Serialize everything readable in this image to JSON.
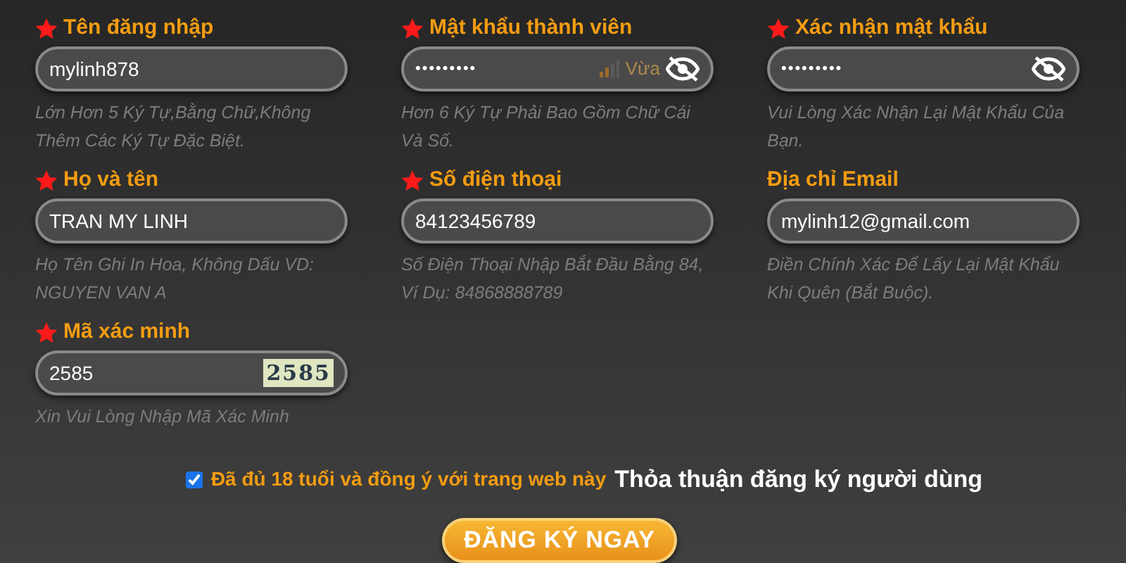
{
  "fields": [
    {
      "kind": "text",
      "label": "Tên đăng nhập",
      "required": true,
      "value": "mylinh878",
      "hint": "Lớn Hơn 5 Ký Tự,Bằng Chữ,Không Thêm Các Ký Tự Đặc Biệt."
    },
    {
      "kind": "password",
      "label": "Mật khẩu thành viên",
      "required": true,
      "value": "•••••••••",
      "strength": "Vừa",
      "hint": "Hơn 6 Ký Tự Phải Bao Gồm Chữ Cái Và Số."
    },
    {
      "kind": "password",
      "label": "Xác nhận mật khẩu",
      "required": true,
      "value": "•••••••••",
      "hint": "Vui Lòng Xác Nhận Lại Mật Khẩu Của Bạn."
    },
    {
      "kind": "text",
      "label": "Họ và tên",
      "required": true,
      "value": "TRAN MY LINH",
      "hint": "Họ Tên Ghi In Hoa, Không Dấu VD: NGUYEN VAN A"
    },
    {
      "kind": "text",
      "label": "Số điện thoại",
      "required": true,
      "value": "84123456789",
      "hint": "Số Điện Thoại Nhập Bắt Đầu Bằng 84, Ví Dụ: 84868888789"
    },
    {
      "kind": "text",
      "label": "Địa chỉ Email",
      "required": false,
      "value": "mylinh12@gmail.com",
      "hint": "Điền Chính Xác Để Lấy Lại Mật Khẩu Khi Quên (Bắt Buộc)."
    },
    {
      "kind": "captcha",
      "label": "Mã xác minh",
      "required": true,
      "value": "2585",
      "captcha": "2585",
      "hint": "Xin Vui Lòng Nhập Mã Xác Minh"
    }
  ],
  "agreement": {
    "checked": true,
    "text": "Đã đủ 18 tuổi và đồng ý với trang web này",
    "link": "Thỏa thuận đăng ký người dùng"
  },
  "submit": "ĐĂNG KÝ NGAY"
}
